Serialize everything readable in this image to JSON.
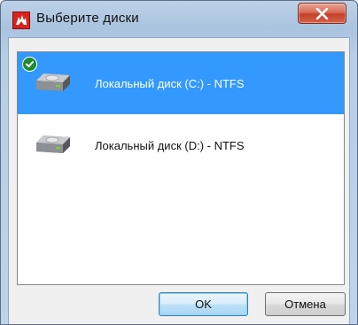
{
  "window": {
    "title": "Выберите диски",
    "app_icon": "app-logo-icon",
    "close_icon": "close-icon"
  },
  "drives": [
    {
      "label": "Локальный диск (C:) - NTFS",
      "selected": true,
      "checked": true,
      "icon": "hard-drive-icon"
    },
    {
      "label": "Локальный диск (D:) - NTFS",
      "selected": false,
      "checked": false,
      "icon": "hard-drive-icon"
    }
  ],
  "buttons": {
    "ok_label": "OK",
    "cancel_label": "Отмена"
  },
  "colors": {
    "selection": "#3399ff",
    "check_badge": "#1f8c2c",
    "app_icon": "#d9231f"
  }
}
